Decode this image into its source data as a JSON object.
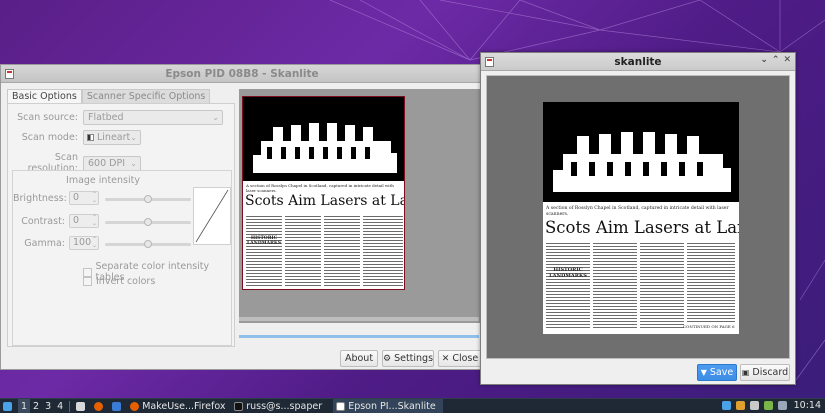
{
  "main_window": {
    "title": "Epson PID 08B8 - Skanlite",
    "tabs": [
      "Basic Options",
      "Scanner Specific Options"
    ],
    "scan_source_label": "Scan source:",
    "scan_source_value": "Flatbed",
    "scan_mode_label": "Scan mode:",
    "scan_mode_value": "Lineart",
    "scan_resolution_label": "Scan resolution:",
    "scan_resolution_value": "600 DPI",
    "intensity_title": "Image intensity",
    "brightness_label": "Brightness:",
    "brightness_value": "0",
    "contrast_label": "Contrast:",
    "contrast_value": "0",
    "gamma_label": "Gamma:",
    "gamma_value": "100",
    "brightness_level": 0.5,
    "contrast_level": 0.5,
    "gamma_level": 0.5,
    "separate_label": "Separate color intensity tables",
    "invert_label": "Invert colors",
    "about_label": "About",
    "settings_label": "Settings",
    "close_label": "Close"
  },
  "newspaper": {
    "caption": "A section of Rosslyn Chapel in Scotland, captured in intricate detail with laser scanners.",
    "headline": "Scots Aim Lasers at Landmarks",
    "deck_left": "HISTORIC LANDMARKS",
    "credit": "CONTINUED ON PAGE 6"
  },
  "preview_dialog": {
    "title": "skanlite",
    "save_label": "Save",
    "discard_label": "Discard",
    "window_controls": [
      "⌄",
      "⌃",
      "✕"
    ]
  },
  "taskbar": {
    "workspaces": [
      "1",
      "2",
      "3",
      "4"
    ],
    "tasks": [
      {
        "label": "MakeUse...Firefox",
        "color": "#e66000"
      },
      {
        "label": "russ@s...spaper",
        "color": "#333333"
      },
      {
        "label": "Epson PI...Skanlite",
        "color": "#ffffff"
      }
    ],
    "clock": "10:14"
  },
  "colors": {
    "accent_blue": "#3d8ee6",
    "progress": "#8ec0ea",
    "wallpaper": "#5a1f87"
  }
}
